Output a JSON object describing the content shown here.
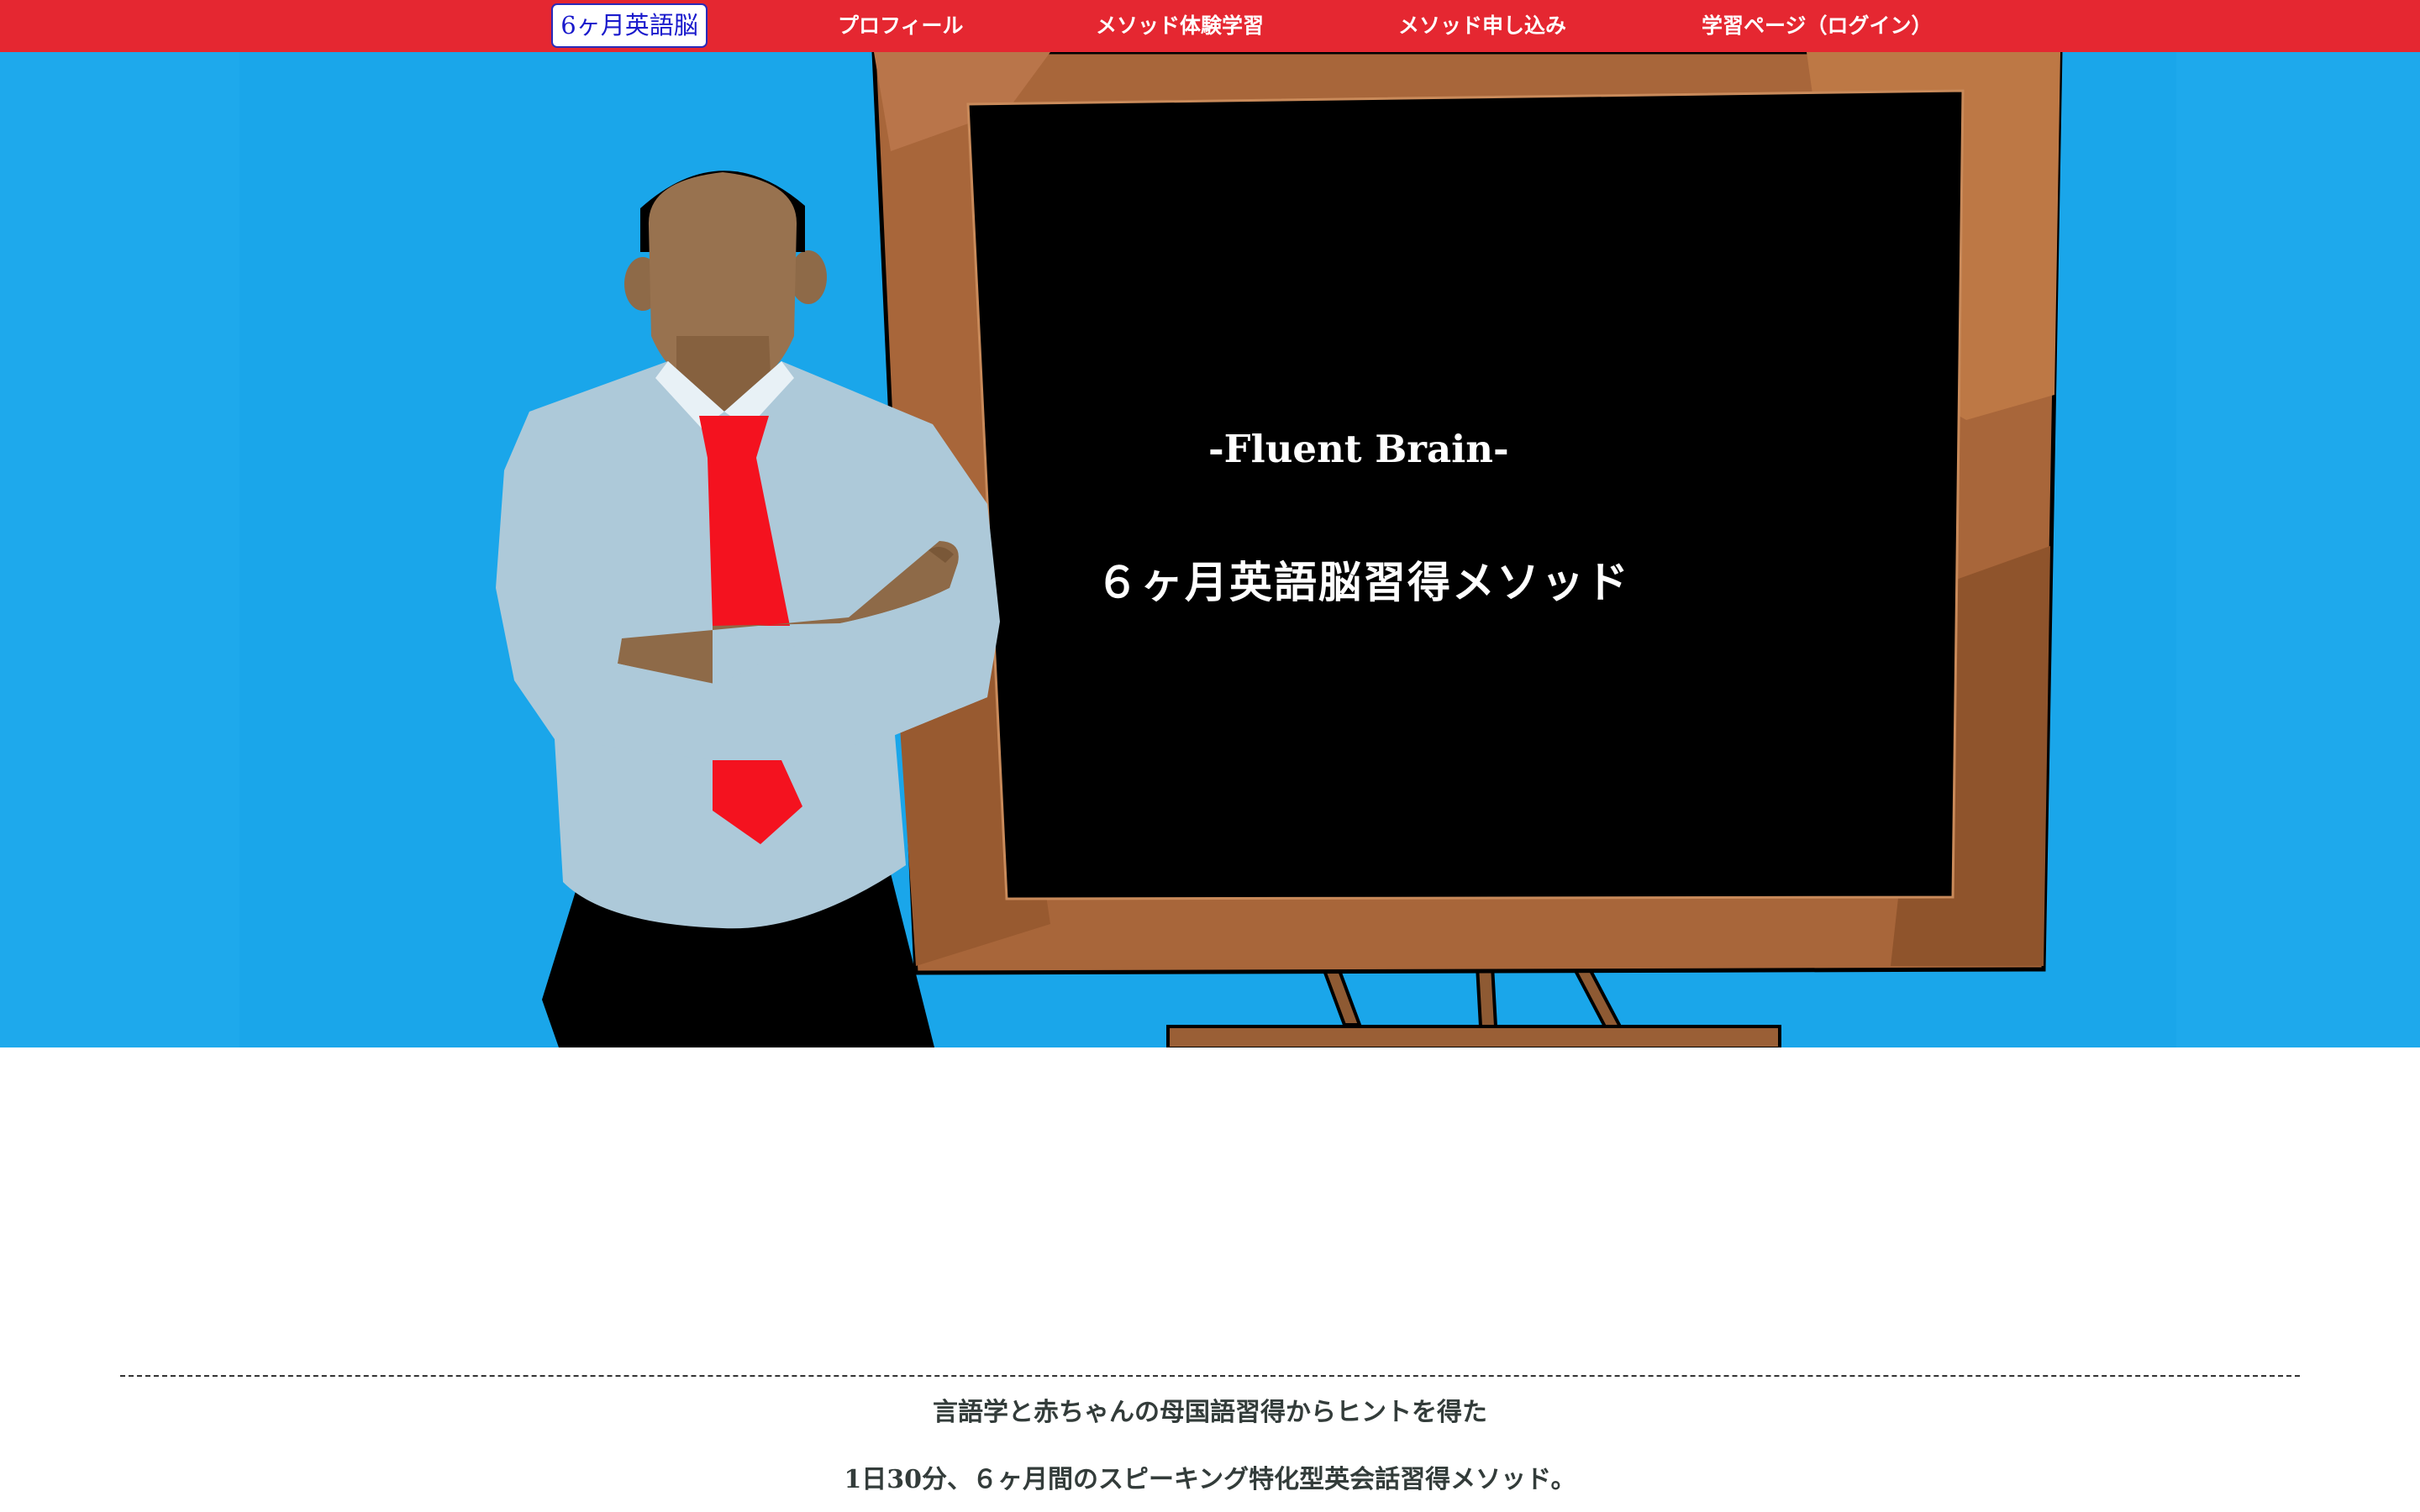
{
  "nav": {
    "home_label": "6ヶ月英語脳",
    "items": [
      {
        "label": "プロフィール"
      },
      {
        "label": "メソッド体験学習"
      },
      {
        "label": "メソッド申し込み"
      },
      {
        "label": "学習ページ（ログイン）"
      }
    ]
  },
  "hero": {
    "board_title": "-Fluent Brain-",
    "board_subtitle": "６ヶ月英語脳習得メソッド"
  },
  "intro": {
    "line1": "言語学と赤ちゃんの母国語習得からヒントを得た",
    "line2": "1日30分、６ヶ月間のスピーキング特化型英会話習得メソッド。"
  },
  "colors": {
    "nav_bg": "#e52731",
    "hero_bg": "#1ea9ec",
    "board": "#000000",
    "frame": "#b06a3a",
    "tie": "#f4121f"
  }
}
